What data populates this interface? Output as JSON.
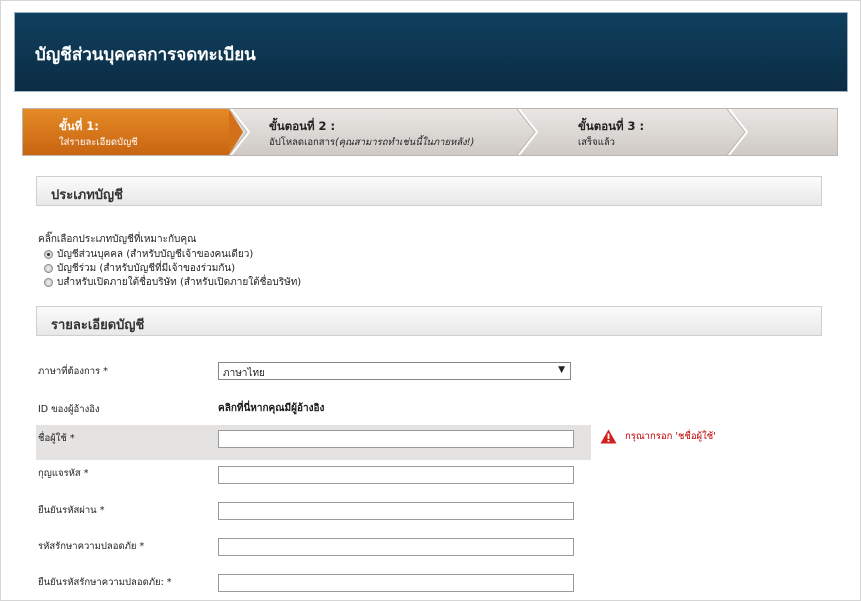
{
  "header": {
    "title": "บัญชีส่วนบุคคลการจดทะเบียน"
  },
  "steps": [
    {
      "title": "ขั้นที่ 1:",
      "subtitle": "ใส่รายละเอียดบัญชี",
      "active": true
    },
    {
      "title": "ขั้นตอนที่ 2 :",
      "subtitle": "อัปโหลดเอกสาร",
      "subtitle_note": "(คุณสามารถทำเช่นนี้ในภายหลัง!)",
      "active": false
    },
    {
      "title": "ขั้นตอนที่ 3 :",
      "subtitle": "เสร็จแล้ว",
      "active": false
    }
  ],
  "account_type": {
    "section_title": "ประเภทบัญชี",
    "intro": "คลิ๊กเลือกประเภทบัญชีที่เหมาะกับคุณ",
    "options": [
      {
        "label": "บัญชีส่วนบุคคล (สำหรับบัญชีเจ้าของคนเดียว)",
        "checked": true
      },
      {
        "label": "บัญชีร่วม (สำหรับบัญชีที่มีเจ้าของร่วมกัน)",
        "checked": false
      },
      {
        "label": "บสำหรับเปิดภายใต้ชื่อบริษัท (สำหรับเปิดภายใต้ชื่อบริษัท)",
        "checked": false
      }
    ]
  },
  "account_details": {
    "section_title": "รายละเอียดบัญชี",
    "language_label": "ภาษาที่ต้องการ *",
    "language_value": "ภาษาไทย",
    "referrer_label": "ID ของผู้อ้างอิง",
    "referrer_link": "คลิกที่นี่หากคุณมีผู้อ้างอิง",
    "username_label": "ชื่อผู้ใช้ *",
    "username_value": "",
    "password_label": "กุญแจรหัส *",
    "confirm_password_label": "ยืนยันรหัสผ่าน *",
    "security_code_label": "รหัสรักษาความปลอดภัย *",
    "confirm_security_code_label": "ยืนยันรหัสรักษาความปลอดภัย: *",
    "error_message": "กรุณากรอก 'ชชื่อผู้ใช้'"
  },
  "colors": {
    "header": "#0d3550",
    "active_step": "#d2711a",
    "error": "#c00000"
  }
}
